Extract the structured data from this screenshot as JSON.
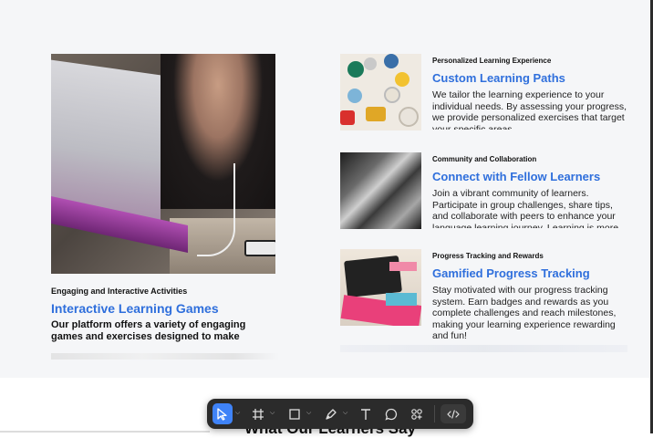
{
  "section": {
    "main_feature": {
      "eyebrow": "Engaging and Interactive Activities",
      "title": "Interactive Learning Games",
      "description": "Our platform offers a variety of engaging games and exercises designed to make language"
    },
    "features": [
      {
        "eyebrow": "Personalized Learning Experience",
        "title": "Custom Learning Paths",
        "description": "We tailor the learning experience to your individual needs. By assessing your progress, we provide personalized exercises that target your specific areas"
      },
      {
        "eyebrow": "Community and Collaboration",
        "title": "Connect with Fellow Learners",
        "description": "Join a vibrant community of learners. Participate in group challenges, share tips, and collaborate with peers to enhance your language learning journey. Learning is more"
      },
      {
        "eyebrow": "Progress Tracking and Rewards",
        "title": "Gamified Progress Tracking",
        "description": "Stay motivated with our progress tracking system. Earn badges and rewards as you complete challenges and reach milestones, making your learning experience rewarding and fun!"
      }
    ]
  },
  "next_section": {
    "heading": "What Our Learners Say"
  },
  "toolbar": {
    "tools": [
      {
        "icon": "cursor-arrow-icon",
        "active": true
      },
      {
        "icon": "frame-hash-icon"
      },
      {
        "icon": "rectangle-icon"
      },
      {
        "icon": "pen-icon"
      },
      {
        "icon": "text-icon"
      },
      {
        "icon": "comment-bubble-icon"
      },
      {
        "icon": "components-icon"
      },
      {
        "icon": "dev-mode-code-icon"
      }
    ],
    "colors": {
      "background": "#2b2b2b",
      "active": "#3f83f8"
    }
  },
  "colors": {
    "accent": "#2f6fdc",
    "section_bg": "#f5f6f8"
  }
}
